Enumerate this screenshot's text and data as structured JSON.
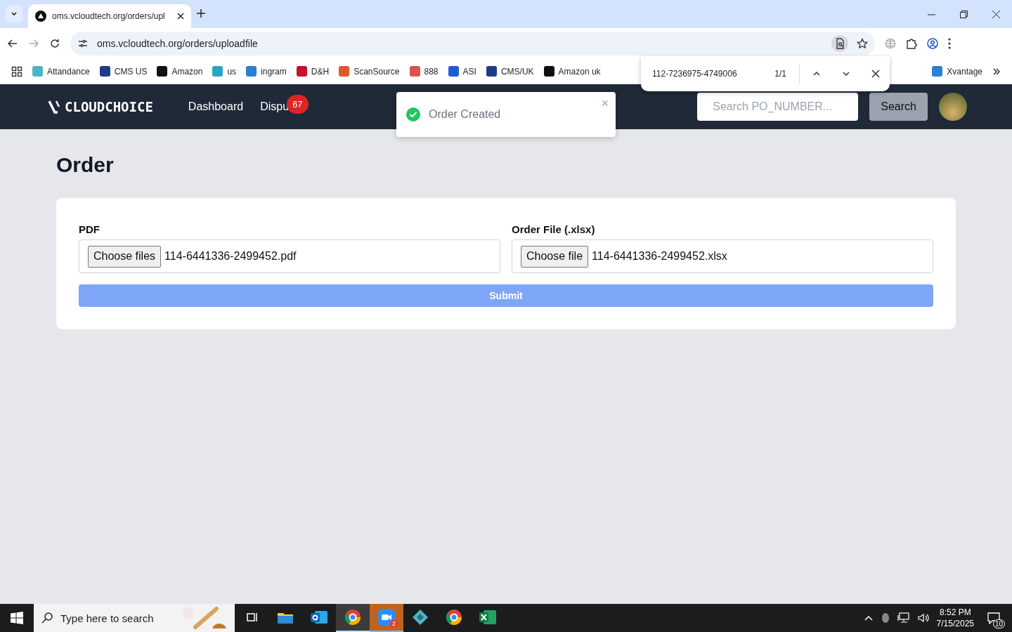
{
  "browser": {
    "tab": {
      "title": "oms.vcloudtech.org/orders/upl"
    },
    "url": "oms.vcloudtech.org/orders/uploadfile",
    "bookmarks": [
      {
        "label": "Attandance",
        "color": "#4fb3c8"
      },
      {
        "label": "CMS US",
        "color": "#1f3c88"
      },
      {
        "label": "Amazon",
        "color": "#111111"
      },
      {
        "label": "us",
        "color": "#2aa3c7"
      },
      {
        "label": "ingram",
        "color": "#2b7fd4"
      },
      {
        "label": "D&H",
        "color": "#c8102e"
      },
      {
        "label": "ScanSource",
        "color": "#e4572e"
      },
      {
        "label": "888",
        "color": "#d9534f"
      },
      {
        "label": "ASI",
        "color": "#1e5bd8"
      },
      {
        "label": "CMS/UK",
        "color": "#1f3c88"
      },
      {
        "label": "Amazon uk",
        "color": "#111111"
      },
      {
        "label": "Xvantage",
        "color": "#2b7fd4"
      }
    ],
    "find_bar": {
      "query": "112-7236975-4749006",
      "count": "1/1"
    }
  },
  "app": {
    "logo": "CLOUDCHOICE",
    "nav": [
      {
        "label": "Dashboard"
      },
      {
        "label": "Dispu",
        "badge": "67"
      }
    ],
    "search": {
      "placeholder": "Search PO_NUMBER...",
      "button": "Search"
    }
  },
  "toast": {
    "message": "Order Created",
    "close": "×"
  },
  "page": {
    "title": "Order",
    "fields": [
      {
        "label": "PDF",
        "button": "Choose files",
        "value": "114-6441336-2499452.pdf"
      },
      {
        "label": "Order File (.xlsx)",
        "button": "Choose file",
        "value": "114-6441336-2499452.xlsx"
      }
    ],
    "submit": "Submit"
  },
  "taskbar": {
    "search_placeholder": "Type here to search",
    "apps": [
      {
        "kind": "taskview",
        "active": false
      },
      {
        "kind": "folder",
        "active": false
      },
      {
        "kind": "outlook",
        "active": false
      },
      {
        "kind": "chrome",
        "active": true
      },
      {
        "kind": "zoom",
        "active": false,
        "attention": true,
        "badge": "2"
      },
      {
        "kind": "diamond",
        "active": false
      },
      {
        "kind": "chrome",
        "active": false
      },
      {
        "kind": "excel",
        "active": false
      }
    ],
    "time": "8:52 PM",
    "date": "7/15/2025",
    "notifications": "10"
  }
}
